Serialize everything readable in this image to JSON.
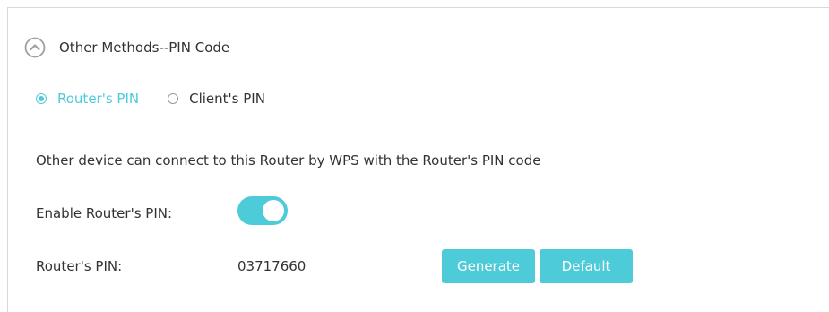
{
  "section": {
    "title": "Other Methods--PIN Code",
    "collapse_icon": "chevron-up-circle-icon"
  },
  "pin_type": {
    "options": [
      {
        "label": "Router's PIN",
        "selected": true
      },
      {
        "label": "Client's PIN",
        "selected": false
      }
    ]
  },
  "description": "Other device can connect to this Router by WPS with the Router's PIN code",
  "enable_pin": {
    "label": "Enable Router's PIN:",
    "enabled": true
  },
  "router_pin": {
    "label": "Router's PIN:",
    "value": "03717660",
    "generate_label": "Generate",
    "default_label": "Default"
  },
  "colors": {
    "accent": "#4ecbd8",
    "text": "#333333",
    "border": "#d9d9d9"
  }
}
